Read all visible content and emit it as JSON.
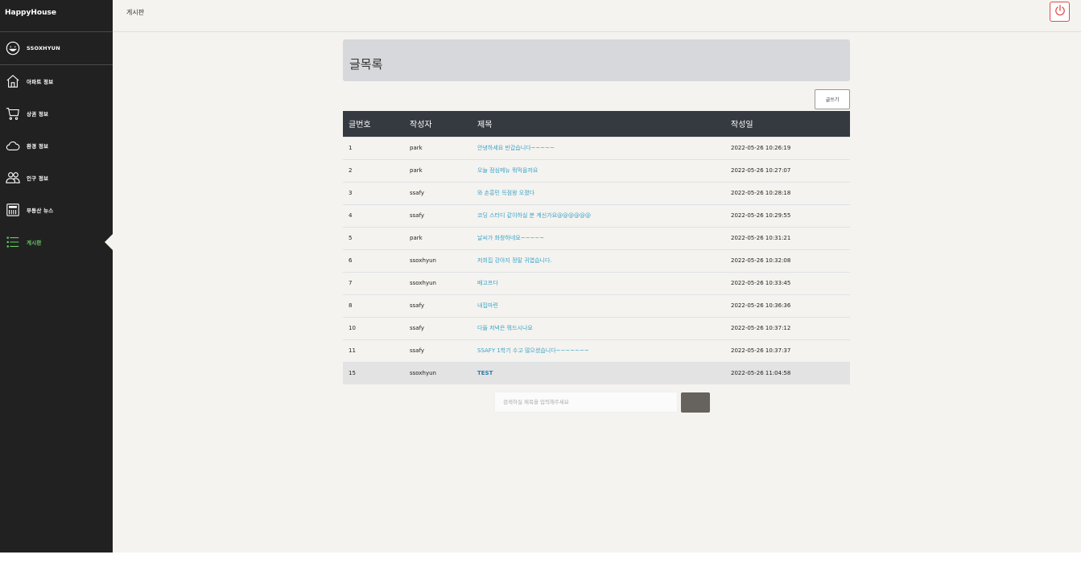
{
  "brand": "HappyHouse",
  "user": {
    "name": "SSOXHYUN"
  },
  "nav": [
    {
      "icon": "home-icon",
      "label": "아파트 정보"
    },
    {
      "icon": "cart-icon",
      "label": "상권 정보"
    },
    {
      "icon": "cloud-icon",
      "label": "환경 정보"
    },
    {
      "icon": "users-icon",
      "label": "인구 정보"
    },
    {
      "icon": "newspaper-icon",
      "label": "부동산 뉴스"
    },
    {
      "icon": "list-icon",
      "label": "게시판",
      "active": true
    }
  ],
  "topbar": {
    "title": "게시판"
  },
  "board": {
    "title": "글목록",
    "write_label": "글쓰기",
    "columns": [
      "글번호",
      "작성자",
      "제목",
      "작성일"
    ],
    "rows": [
      {
        "no": "1",
        "author": "park",
        "title": "안녕하세요 반갑습니다~~~~~",
        "date": "2022-05-26 10:26:19"
      },
      {
        "no": "2",
        "author": "park",
        "title": "오늘 점심메뉴 뭐먹을까요",
        "date": "2022-05-26 10:27:07"
      },
      {
        "no": "3",
        "author": "ssafy",
        "title": "와 손흥민 득점왕 오졌다",
        "date": "2022-05-26 10:28:18"
      },
      {
        "no": "4",
        "author": "ssafy",
        "title": "코딩 스터디 같이하실 분 계신가요@@@@@@",
        "date": "2022-05-26 10:29:55"
      },
      {
        "no": "5",
        "author": "park",
        "title": "날씨가 화창하네요~~~~~",
        "date": "2022-05-26 10:31:21"
      },
      {
        "no": "6",
        "author": "ssoxhyun",
        "title": "저희집 강아지 정말 귀엽습니다.",
        "date": "2022-05-26 10:32:08"
      },
      {
        "no": "7",
        "author": "ssoxhyun",
        "title": "배고프다",
        "date": "2022-05-26 10:33:45"
      },
      {
        "no": "8",
        "author": "ssafy",
        "title": "내집마련",
        "date": "2022-05-26 10:36:36"
      },
      {
        "no": "10",
        "author": "ssafy",
        "title": "다들 저녁은 뭐드시나요",
        "date": "2022-05-26 10:37:12"
      },
      {
        "no": "11",
        "author": "ssafy",
        "title": "SSAFY 1학기 수고 많으셨습니다~~~~~~~",
        "date": "2022-05-26 10:37:37"
      },
      {
        "no": "15",
        "author": "ssoxhyun",
        "title": "TEST",
        "date": "2022-05-26 11:04:58",
        "highlighted": true
      }
    ]
  },
  "search": {
    "placeholder": "검색하실 제목을 입력해주세요",
    "button_label": ""
  },
  "colors": {
    "sidebar_bg": "#212121",
    "header_bg": "#343a40",
    "link": "#3aa3c9",
    "active_nav": "#66cc66",
    "power": "#e04c4c"
  }
}
